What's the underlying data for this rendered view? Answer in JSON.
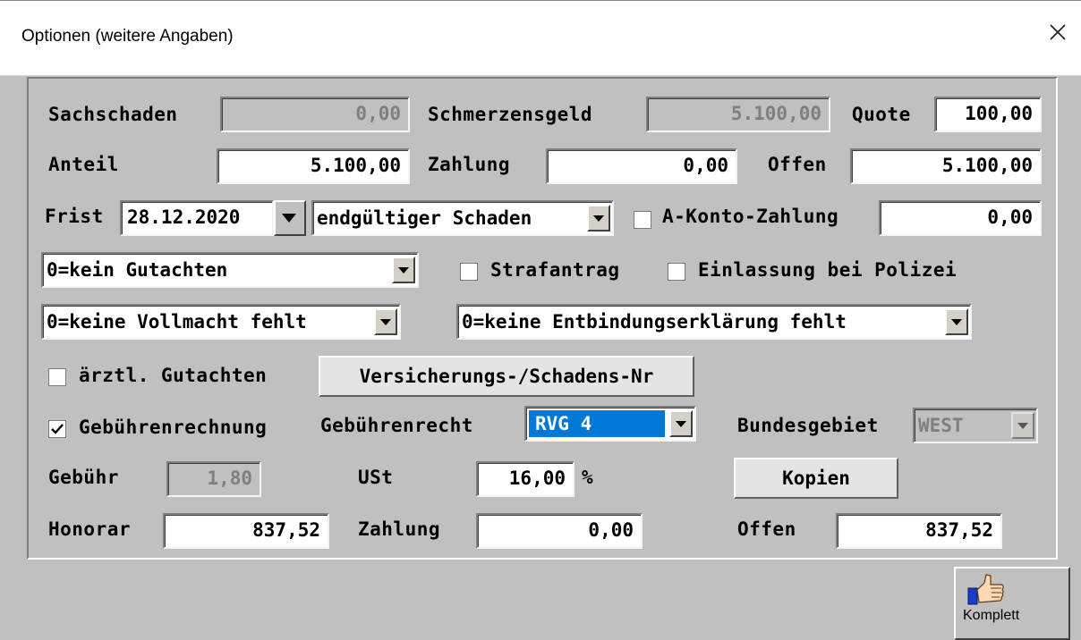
{
  "window": {
    "title": "Optionen (weitere Angaben)"
  },
  "row1": {
    "sachschaden_label": "Sachschaden",
    "sachschaden_value": "0,00",
    "schmerzensgeld_label": "Schmerzensgeld",
    "schmerzensgeld_value": "5.100,00",
    "quote_label": "Quote",
    "quote_value": "100,00"
  },
  "row2": {
    "anteil_label": "Anteil",
    "anteil_value": "5.100,00",
    "zahlung_label": "Zahlung",
    "zahlung_value": "0,00",
    "offen_label": "Offen",
    "offen_value": "5.100,00"
  },
  "row3": {
    "frist_label": "Frist",
    "frist_value": "28.12.2020",
    "schaden_select": "endgültiger Schaden",
    "akonto_label": "A-Konto-Zahlung",
    "akonto_checked": false,
    "akonto_value": "0,00"
  },
  "row4": {
    "gutachten_select": "0=kein Gutachten",
    "strafantrag_label": "Strafantrag",
    "strafantrag_checked": false,
    "einlassung_label": "Einlassung bei Polizei",
    "einlassung_checked": false
  },
  "row5": {
    "vollmacht_select": "0=keine Vollmacht fehlt",
    "entbindung_select": "0=keine Entbindungserklärung fehlt"
  },
  "row6": {
    "aerztl_label": "ärztl. Gutachten",
    "aerztl_checked": false,
    "versicherung_button": "Versicherungs-/Schadens-Nr"
  },
  "row7": {
    "gebuehrenrechnung_label": "Gebührenrechnung",
    "gebuehrenrechnung_checked": true,
    "gebuehrenrecht_label": "Gebührenrecht",
    "gebuehrenrecht_value": "RVG 4",
    "bundesgebiet_label": "Bundesgebiet",
    "bundesgebiet_value": "WEST"
  },
  "row8": {
    "gebuehr_label": "Gebühr",
    "gebuehr_value": "1,80",
    "ust_label": "USt",
    "ust_value": "16,00",
    "percent": "%",
    "kopien_button": "Kopien"
  },
  "row9": {
    "honorar_label": "Honorar",
    "honorar_value": "837,52",
    "zahlung_label": "Zahlung",
    "zahlung_value": "0,00",
    "offen_label": "Offen",
    "offen_value": "837,52"
  },
  "footer": {
    "komplett_label": "Komplett",
    "komplett_icon": "thumbs-up-icon"
  },
  "colors": {
    "selection": "#0078d7",
    "dialog_bg": "#c0c0c0"
  }
}
